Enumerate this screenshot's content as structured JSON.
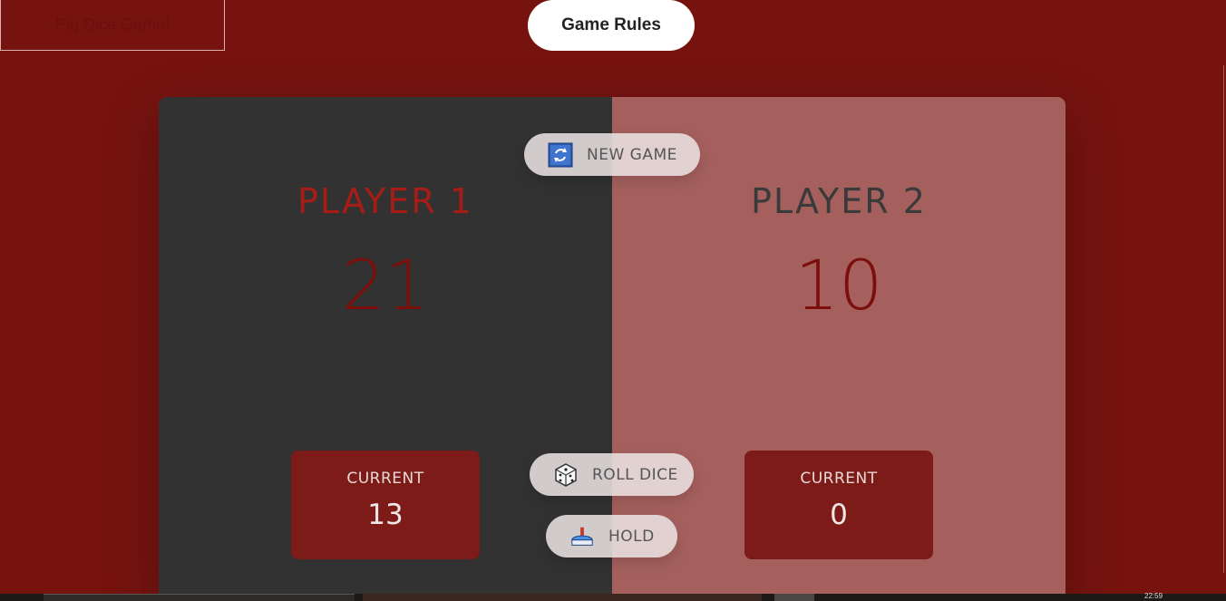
{
  "app": {
    "title": "Pig Dice Game!"
  },
  "header": {
    "rules_label": "Game Rules"
  },
  "players": [
    {
      "name": "PLAYER 1",
      "score": "21",
      "current_label": "CURRENT",
      "current_score": "13",
      "active": true
    },
    {
      "name": "PLAYER 2",
      "score": "10",
      "current_label": "CURRENT",
      "current_score": "0",
      "active": false
    }
  ],
  "controls": {
    "new_game_label": "NEW GAME",
    "new_game_icon": "refresh-icon",
    "roll_dice_label": "ROLL DICE",
    "roll_dice_icon": "dice-icon",
    "hold_label": "HOLD",
    "hold_icon": "hold-icon"
  },
  "taskbar": {
    "clock": "22:59"
  },
  "colors": {
    "background": "#76130f",
    "player1_panel": "#323232",
    "player2_panel": "#a5605e",
    "accent": "#a81c18",
    "current_box": "#7c1b17"
  }
}
